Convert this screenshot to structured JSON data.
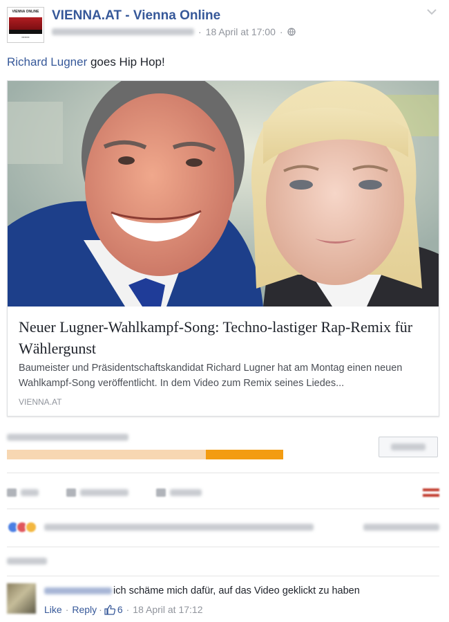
{
  "header": {
    "page_name": "VIENNA.AT - Vienna Online",
    "logo_text": "VIENNA ONLINE",
    "date": "18 April at 17:00",
    "separator": "·"
  },
  "post": {
    "mention": "Richard Lugner",
    "text_rest": " goes Hip Hop!"
  },
  "link_preview": {
    "title": "Neuer Lugner-Wahlkampf-Song: Techno-lastiger Rap-Remix für Wählergunst",
    "description": "Baumeister und Präsidentschaftskandidat Richard Lugner hat am Montag einen neuen Wahlkampf-Song veröffentlicht. In dem Video zum Remix seines Liedes...",
    "domain": "VIENNA.AT"
  },
  "reach": {
    "fraction_organic": 0.72,
    "fraction_paid": 0.28,
    "colors": {
      "organic": "#f7d7b2",
      "paid": "#f39c12"
    }
  },
  "comment": {
    "text": "ich schäme mich dafür, auf das Video geklickt zu haben",
    "like_label": "Like",
    "reply_label": "Reply",
    "like_count": "6",
    "date": "18 April at 17:12",
    "separator": "·"
  },
  "colors": {
    "link": "#365899",
    "meta": "#90949c",
    "text": "#1d2129"
  }
}
